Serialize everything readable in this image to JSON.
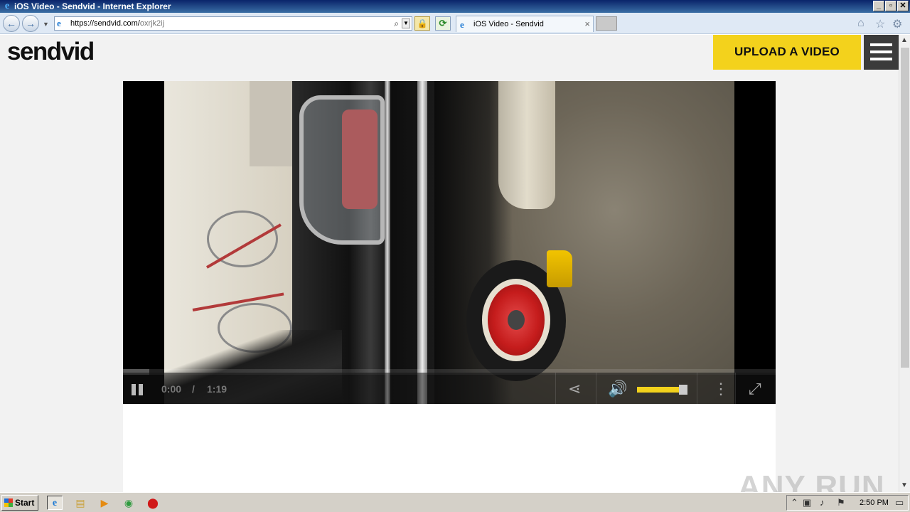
{
  "window": {
    "title": "iOS Video - Sendvid - Internet Explorer",
    "controls": [
      "_",
      "▫",
      "✕"
    ]
  },
  "browser": {
    "address_host": "https://sendvid.com/",
    "address_path": "oxrjk2ij",
    "tab_title": "iOS Video - Sendvid",
    "tab_close": "×"
  },
  "site": {
    "logo": "sendvid",
    "upload_label": "UPLOAD A VIDEO"
  },
  "player": {
    "current_time": "0:00",
    "separator": "/",
    "duration": "1:19",
    "buffered_fraction": 0.04,
    "volume_fraction": 0.85,
    "accent": "#f3d21c"
  },
  "watermark": "ANY RUN",
  "taskbar": {
    "start_label": "Start",
    "clock": "2:50 PM"
  }
}
